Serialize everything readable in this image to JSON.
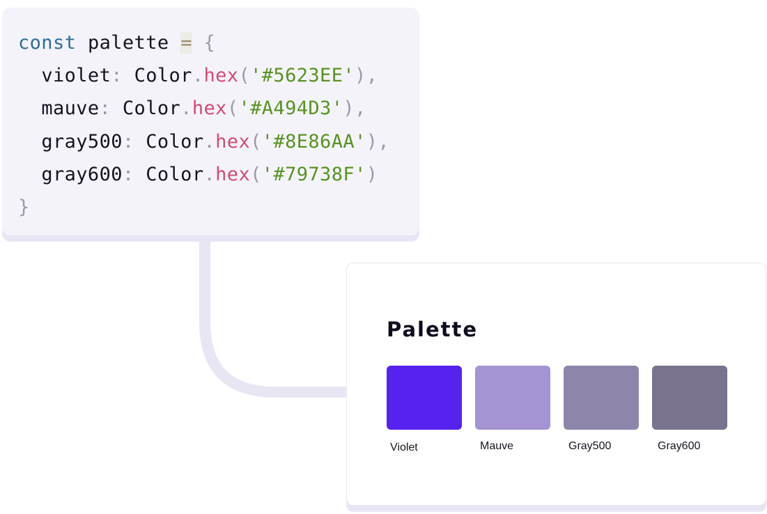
{
  "code": {
    "lines": [
      {
        "keyword": "const",
        "identifier": "palette",
        "operator": "=",
        "brace": "{"
      },
      {
        "key": "violet",
        "colon": ":",
        "object": "Color",
        "dot": ".",
        "method": "hex",
        "open": "(",
        "value": "'#5623EE'",
        "close": "),",
        "color": "#5623EE"
      },
      {
        "key": "mauve",
        "colon": ":",
        "object": "Color",
        "dot": ".",
        "method": "hex",
        "open": "(",
        "value": "'#A494D3'",
        "close": "),",
        "color": "#A494D3"
      },
      {
        "key": "gray500",
        "colon": ":",
        "object": "Color",
        "dot": ".",
        "method": "hex",
        "open": "(",
        "value": "'#8E86AA'",
        "close": "),",
        "color": "#8E86AA"
      },
      {
        "key": "gray600",
        "colon": ":",
        "object": "Color",
        "dot": ".",
        "method": "hex",
        "open": "(",
        "value": "'#79738F'",
        "close": ")",
        "color": "#79738F"
      },
      {
        "brace": "}"
      }
    ]
  },
  "palette": {
    "title": "Palette",
    "swatches": [
      {
        "label": "Violet",
        "color": "#5623EE"
      },
      {
        "label": "Mauve",
        "color": "#A494D3"
      },
      {
        "label": "Gray500",
        "color": "#8E86AA"
      },
      {
        "label": "Gray600",
        "color": "#79738F"
      }
    ]
  },
  "colors": {
    "code_background": "#F4F3FA",
    "connector": "#E8E6F3",
    "keyword": "#2A6E9A",
    "method": "#D24C73",
    "string": "#58931F"
  }
}
